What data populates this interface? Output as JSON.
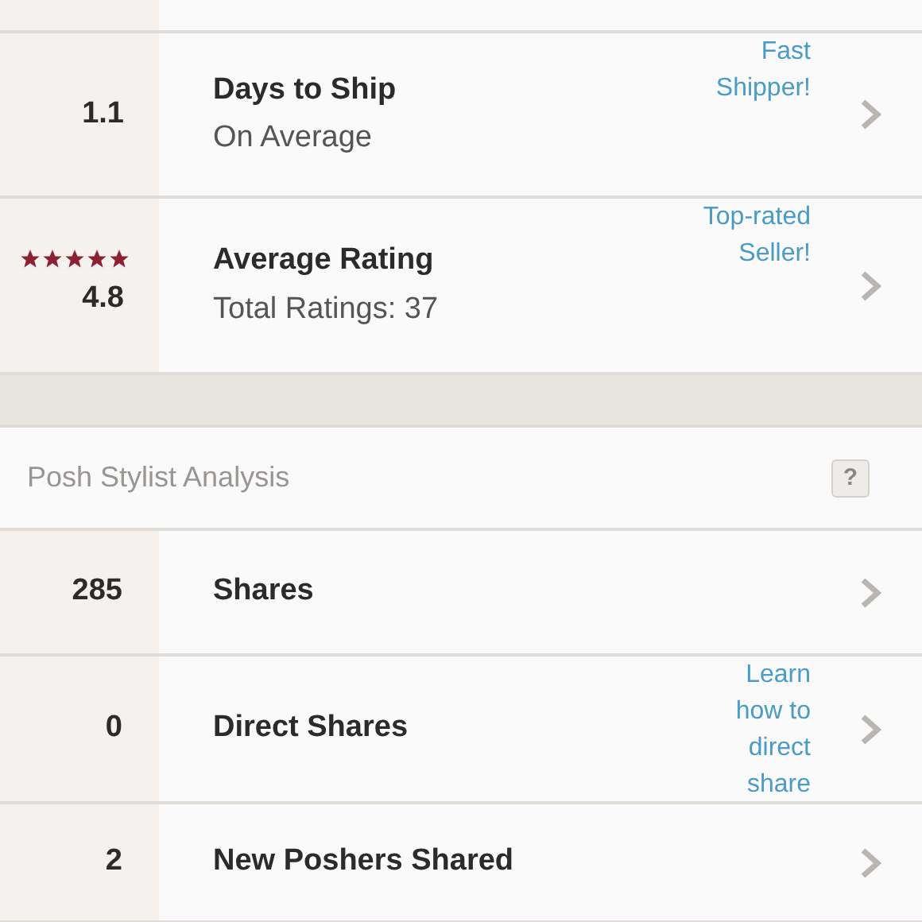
{
  "seller_stats": [
    {
      "value": "1.1",
      "title": "Days to Ship",
      "subtitle": "On Average",
      "link": "Fast Shipper!"
    },
    {
      "stars": 5,
      "value": "4.8",
      "title": "Average Rating",
      "subtitle": "Total Ratings: 37",
      "link": "Top-rated Seller!"
    }
  ],
  "analysis": {
    "title": "Posh Stylist Analysis",
    "help": "?",
    "rows": [
      {
        "value": "285",
        "title": "Shares"
      },
      {
        "value": "0",
        "title": "Direct Shares",
        "link": "Learn how to direct share"
      },
      {
        "value": "2",
        "title": "New Poshers Shared"
      }
    ]
  }
}
